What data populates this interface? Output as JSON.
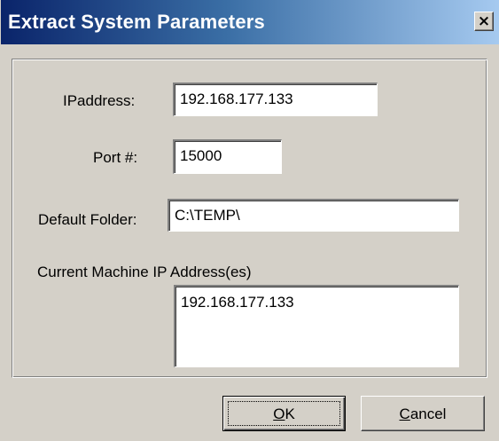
{
  "dialog": {
    "title": "Extract System Parameters",
    "close_glyph": "×"
  },
  "fields": {
    "ip_address": {
      "label": "IPaddress:",
      "value": "192.168.177.133"
    },
    "port": {
      "label": "Port #:",
      "value": "15000"
    },
    "default_folder": {
      "label": "Default Folder:",
      "value": "C:\\TEMP\\"
    },
    "current_ips": {
      "label": "Current Machine IP Address(es)",
      "value": "192.168.177.133"
    }
  },
  "buttons": {
    "ok": {
      "mnemonic": "O",
      "rest": "K"
    },
    "cancel": {
      "mnemonic": "C",
      "rest": "ancel"
    }
  },
  "colors": {
    "title_start": "#0a246a",
    "title_end": "#a6caf0",
    "face": "#d4d0c8"
  },
  "icons": {
    "close": "close-icon"
  }
}
